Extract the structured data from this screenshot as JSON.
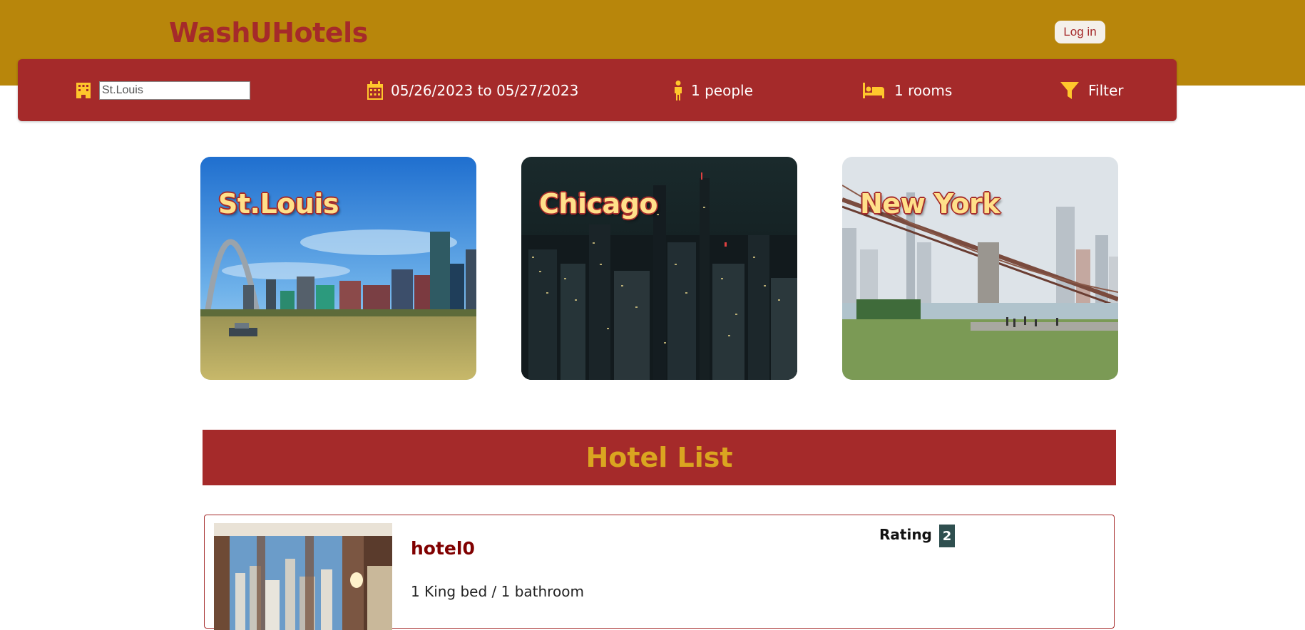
{
  "header": {
    "brand": "WashUHotels",
    "login_label": "Log in"
  },
  "search": {
    "city_value": "St.Louis",
    "city_placeholder": "St.Louis",
    "dates": "05/26/2023 to 05/27/2023",
    "people": "1 people",
    "rooms": "1 rooms",
    "filter_label": "Filter",
    "icons": [
      "building-icon",
      "calendar-icon",
      "person-icon",
      "bed-icon",
      "filter-icon"
    ]
  },
  "cities": [
    {
      "name": "St.Louis"
    },
    {
      "name": "Chicago"
    },
    {
      "name": "New York"
    }
  ],
  "hotel_list": {
    "title": "Hotel List",
    "hotels": [
      {
        "name": "hotel0",
        "description": "1 King bed / 1 bathroom",
        "rating_label": "Rating",
        "rating": "2"
      }
    ]
  },
  "colors": {
    "header_gold": "#b8860b",
    "brand_red": "#a52a2a",
    "icon_yellow": "#ffc72c",
    "title_gold": "#daa520",
    "hotel_name": "#800000",
    "rating_badge": "#2f4f4f"
  }
}
